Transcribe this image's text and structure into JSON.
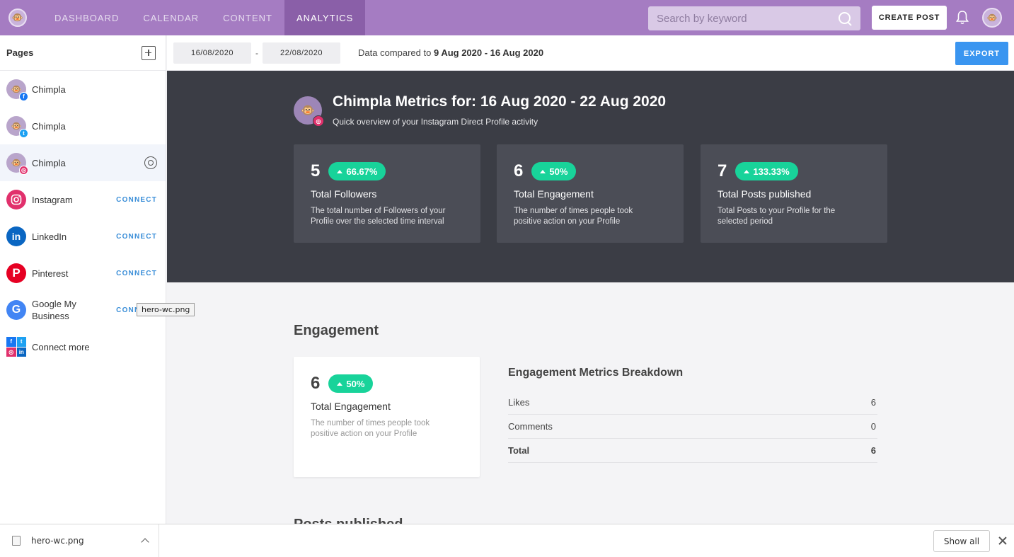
{
  "colors": {
    "topbar": "#a57cc2",
    "nav_active": "#8a5fa8",
    "hero_bg": "#3b3d45",
    "card_bg": "#4b4d56",
    "pill_green": "#18d39a",
    "export_blue": "#3a95f0",
    "connect_blue": "#3a8ed8",
    "facebook": "#1877f2",
    "twitter": "#1da1f2",
    "instagram": "#e1306c",
    "linkedin": "#0a66c2",
    "pinterest": "#e60023",
    "google": "#4285f4"
  },
  "nav": {
    "items": [
      {
        "label": "DASHBOARD"
      },
      {
        "label": "CALENDAR"
      },
      {
        "label": "CONTENT"
      },
      {
        "label": "ANALYTICS"
      }
    ],
    "active": "ANALYTICS",
    "search_placeholder": "Search by keyword",
    "create_label": "CREATE POST"
  },
  "sidebar": {
    "title": "Pages",
    "pages": [
      {
        "label": "Chimpla",
        "network": "facebook",
        "badge": "f"
      },
      {
        "label": "Chimpla",
        "network": "twitter",
        "badge": "t"
      },
      {
        "label": "Chimpla",
        "network": "instagram",
        "badge": "◎"
      }
    ],
    "connect_items": [
      {
        "label": "Instagram",
        "icon": "instagram-icon",
        "action": "CONNECT"
      },
      {
        "label": "LinkedIn",
        "icon": "linkedin-icon",
        "action": "CONNECT"
      },
      {
        "label": "Pinterest",
        "icon": "pinterest-icon",
        "action": "CONNECT"
      },
      {
        "label": "Google My Business",
        "icon": "google-icon",
        "action": "CONNECT"
      }
    ],
    "connect_more": "Connect more",
    "tooltip": "hero-wc.png"
  },
  "filter": {
    "date_from": "16/08/2020",
    "date_sep": "-",
    "date_to": "22/08/2020",
    "compare_prefix": "Data compared to ",
    "compare_range": "9 Aug 2020 - 16 Aug 2020",
    "export_label": "EXPORT"
  },
  "hero": {
    "title": "Chimpla Metrics for: 16 Aug 2020 - 22 Aug 2020",
    "subtitle": "Quick overview of your Instagram Direct Profile activity",
    "cards": [
      {
        "value": "5",
        "change": "66.67%",
        "title": "Total Followers",
        "desc": "The total number of Followers of your Profile over the selected time interval"
      },
      {
        "value": "6",
        "change": "50%",
        "title": "Total Engagement",
        "desc": "The number of times people took positive action on your Profile"
      },
      {
        "value": "7",
        "change": "133.33%",
        "title": "Total Posts published",
        "desc": "Total Posts to your Profile for the selected period"
      }
    ]
  },
  "engagement": {
    "title": "Engagement",
    "card": {
      "value": "6",
      "change": "50%",
      "title": "Total Engagement",
      "desc": "The number of times people took positive action on your Profile"
    },
    "breakdown": {
      "title": "Engagement Metrics Breakdown",
      "rows": [
        {
          "label": "Likes",
          "value": "6"
        },
        {
          "label": "Comments",
          "value": "0"
        },
        {
          "label": "Total",
          "value": "6"
        }
      ]
    }
  },
  "posts_title": "Posts published",
  "download": {
    "file": "hero-wc.png",
    "show_all": "Show all"
  }
}
